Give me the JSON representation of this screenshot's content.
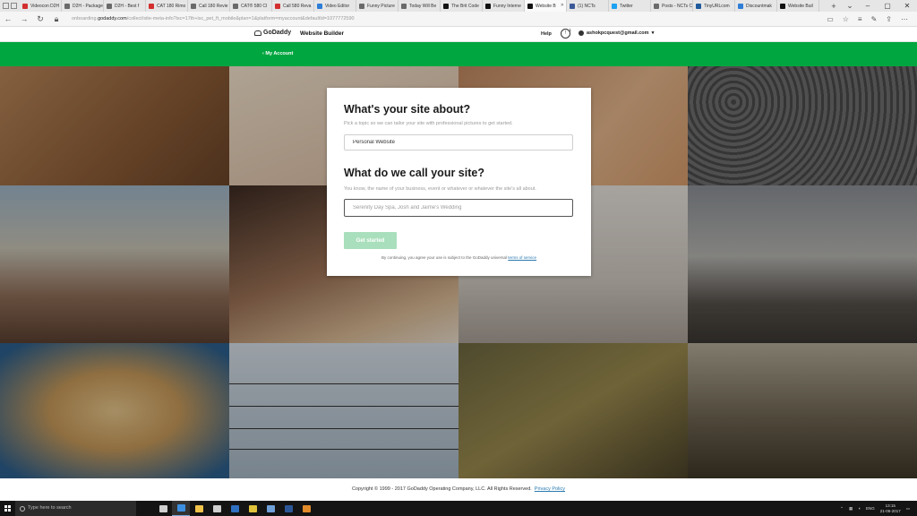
{
  "browser": {
    "tabs": [
      {
        "label": "Videocon D2H",
        "color": "#d32f2f"
      },
      {
        "label": "D2H - Packages",
        "color": "#6a6a6a"
      },
      {
        "label": "D2H - Best f",
        "color": "#6a6a6a"
      },
      {
        "label": "CAT 180 Rimo",
        "color": "#d32f2f"
      },
      {
        "label": "Call 180 Revie",
        "color": "#6a6a6a"
      },
      {
        "label": "CAT® 580 CI",
        "color": "#6a6a6a"
      },
      {
        "label": "Call 580 Reva",
        "color": "#d32f2f"
      },
      {
        "label": "Video Editor",
        "color": "#2e7dd7"
      },
      {
        "label": "Funny Picture",
        "color": "#6a6a6a"
      },
      {
        "label": "Today Will Be",
        "color": "#6a6a6a"
      },
      {
        "label": "The Brit Code",
        "color": "#111111"
      },
      {
        "label": "Funny Interne",
        "color": "#111111"
      },
      {
        "label": "Website B",
        "color": "#111111",
        "active": true
      },
      {
        "label": "(1) NCTs",
        "color": "#3b5998"
      },
      {
        "label": "Twitter",
        "color": "#1da1f2"
      },
      {
        "label": "Posts - NCTs C",
        "color": "#6a6a6a"
      },
      {
        "label": "TinyURLcom",
        "color": "#1f5a9c"
      },
      {
        "label": "Discountmak",
        "color": "#2e7dd7"
      },
      {
        "label": "Website Buil",
        "color": "#111111"
      }
    ],
    "url_prefix": "onboarding.",
    "url_domain": "godaddy.com",
    "url_rest": "/collect/site-meta-info?isc=17th+isc_pet_ft_mobile&plan=1&platform=myaccount&defaultId=1077772590"
  },
  "header": {
    "logo_text": "GoDaddy",
    "product": "Website Builder",
    "help": "Help",
    "notifications_count": "1",
    "account_email": "ashokpcquest@gmail.com",
    "account_caret": "▾"
  },
  "greenbar": {
    "my_account": "‹ My Account",
    "accent": "#00a63f"
  },
  "modal": {
    "q1": "What's your site about?",
    "help1": "Pick a topic so we can tailor your site with professional pictures to get started.",
    "topic_value": "Personal Website",
    "q2": "What do we call your site?",
    "help2": "You know, the name of your business, event or whatever or whatever the site's all about.",
    "name_placeholder": "Serenity Day Spa, Josh and Jaime's Wedding",
    "start_label": "Get started",
    "terms_prefix": "By continuing, you agree your use is subject to the GoDaddy universal",
    "terms_link": "terms of service"
  },
  "footer": {
    "copyright": "Copyright © 1999 - 2017 GoDaddy Operating Company, LLC. All Rights Reserved.",
    "privacy": "Privacy Policy"
  },
  "taskbar": {
    "search_placeholder": "Type here to search",
    "apps": [
      {
        "name": "task-view",
        "color": "#cfcfcf"
      },
      {
        "name": "edge",
        "color": "#3c8fe0"
      },
      {
        "name": "file-explorer",
        "color": "#f0c24a"
      },
      {
        "name": "store",
        "color": "#cfcfcf"
      },
      {
        "name": "mail",
        "color": "#2f6fc0"
      },
      {
        "name": "chrome",
        "color": "#e0c23a"
      },
      {
        "name": "photos",
        "color": "#6fa0d8"
      },
      {
        "name": "word",
        "color": "#2b5797"
      },
      {
        "name": "media",
        "color": "#e08a2a"
      }
    ],
    "language": "ENG",
    "time": "13:15",
    "date": "21-06-2017"
  }
}
